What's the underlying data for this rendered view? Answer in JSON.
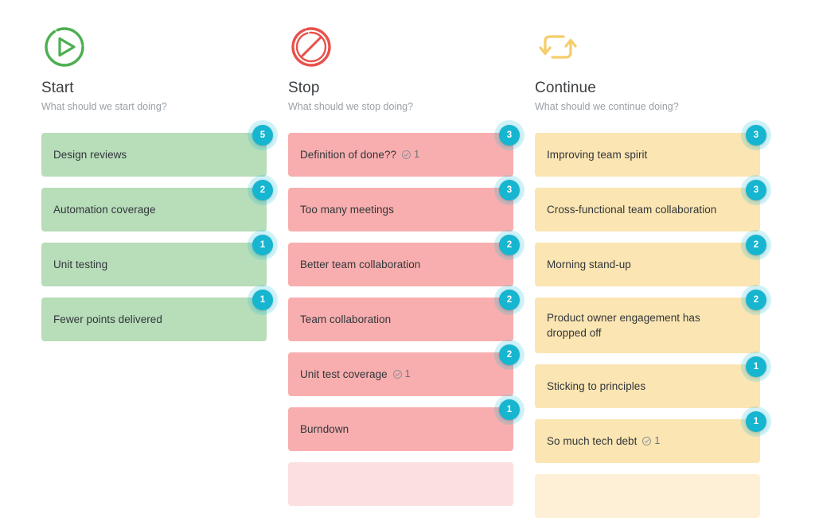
{
  "board": {
    "background_color": "#ffffff",
    "badge_color": "#16b5d0",
    "columns": [
      {
        "id": "start",
        "title": "Start",
        "subtitle": "What should we start doing?",
        "icon": "play-circle-icon",
        "icon_color": "#4caf50",
        "card_color": "#b7ddb9",
        "cards": [
          {
            "text": "Design reviews",
            "votes": "5",
            "actions": null,
            "ghost": false
          },
          {
            "text": "Automation coverage",
            "votes": "2",
            "actions": null,
            "ghost": false
          },
          {
            "text": "Unit testing",
            "votes": "1",
            "actions": null,
            "ghost": false
          },
          {
            "text": "Fewer points delivered",
            "votes": "1",
            "actions": null,
            "ghost": false
          }
        ]
      },
      {
        "id": "stop",
        "title": "Stop",
        "subtitle": "What should we stop doing?",
        "icon": "no-entry-icon",
        "icon_color": "#e8514b",
        "card_color": "#f8aeae",
        "cards": [
          {
            "text": "Definition of done??",
            "votes": "3",
            "actions": "1",
            "ghost": false
          },
          {
            "text": "Too many meetings",
            "votes": "3",
            "actions": null,
            "ghost": false
          },
          {
            "text": "Better team collaboration",
            "votes": "2",
            "actions": null,
            "ghost": false
          },
          {
            "text": "Team collaboration",
            "votes": "2",
            "actions": null,
            "ghost": false
          },
          {
            "text": "Unit test coverage",
            "votes": "2",
            "actions": "1",
            "ghost": false
          },
          {
            "text": "Burndown",
            "votes": "1",
            "actions": null,
            "ghost": false
          },
          {
            "text": "",
            "votes": null,
            "actions": null,
            "ghost": true
          }
        ]
      },
      {
        "id": "continue",
        "title": "Continue",
        "subtitle": "What should we continue doing?",
        "icon": "recycle-arrows-icon",
        "icon_color": "#f5cd6a",
        "card_color": "#fbe5b2",
        "cards": [
          {
            "text": "Improving team spirit",
            "votes": "3",
            "actions": null,
            "ghost": false
          },
          {
            "text": "Cross-functional team collaboration",
            "votes": "3",
            "actions": null,
            "ghost": false
          },
          {
            "text": "Morning stand-up",
            "votes": "2",
            "actions": null,
            "ghost": false
          },
          {
            "text": "Product owner engagement has dropped off",
            "votes": "2",
            "actions": null,
            "ghost": false
          },
          {
            "text": "Sticking to principles",
            "votes": "1",
            "actions": null,
            "ghost": false
          },
          {
            "text": "So much tech debt",
            "votes": "1",
            "actions": "1",
            "ghost": false
          },
          {
            "text": "",
            "votes": null,
            "actions": null,
            "ghost": true
          }
        ]
      }
    ]
  }
}
